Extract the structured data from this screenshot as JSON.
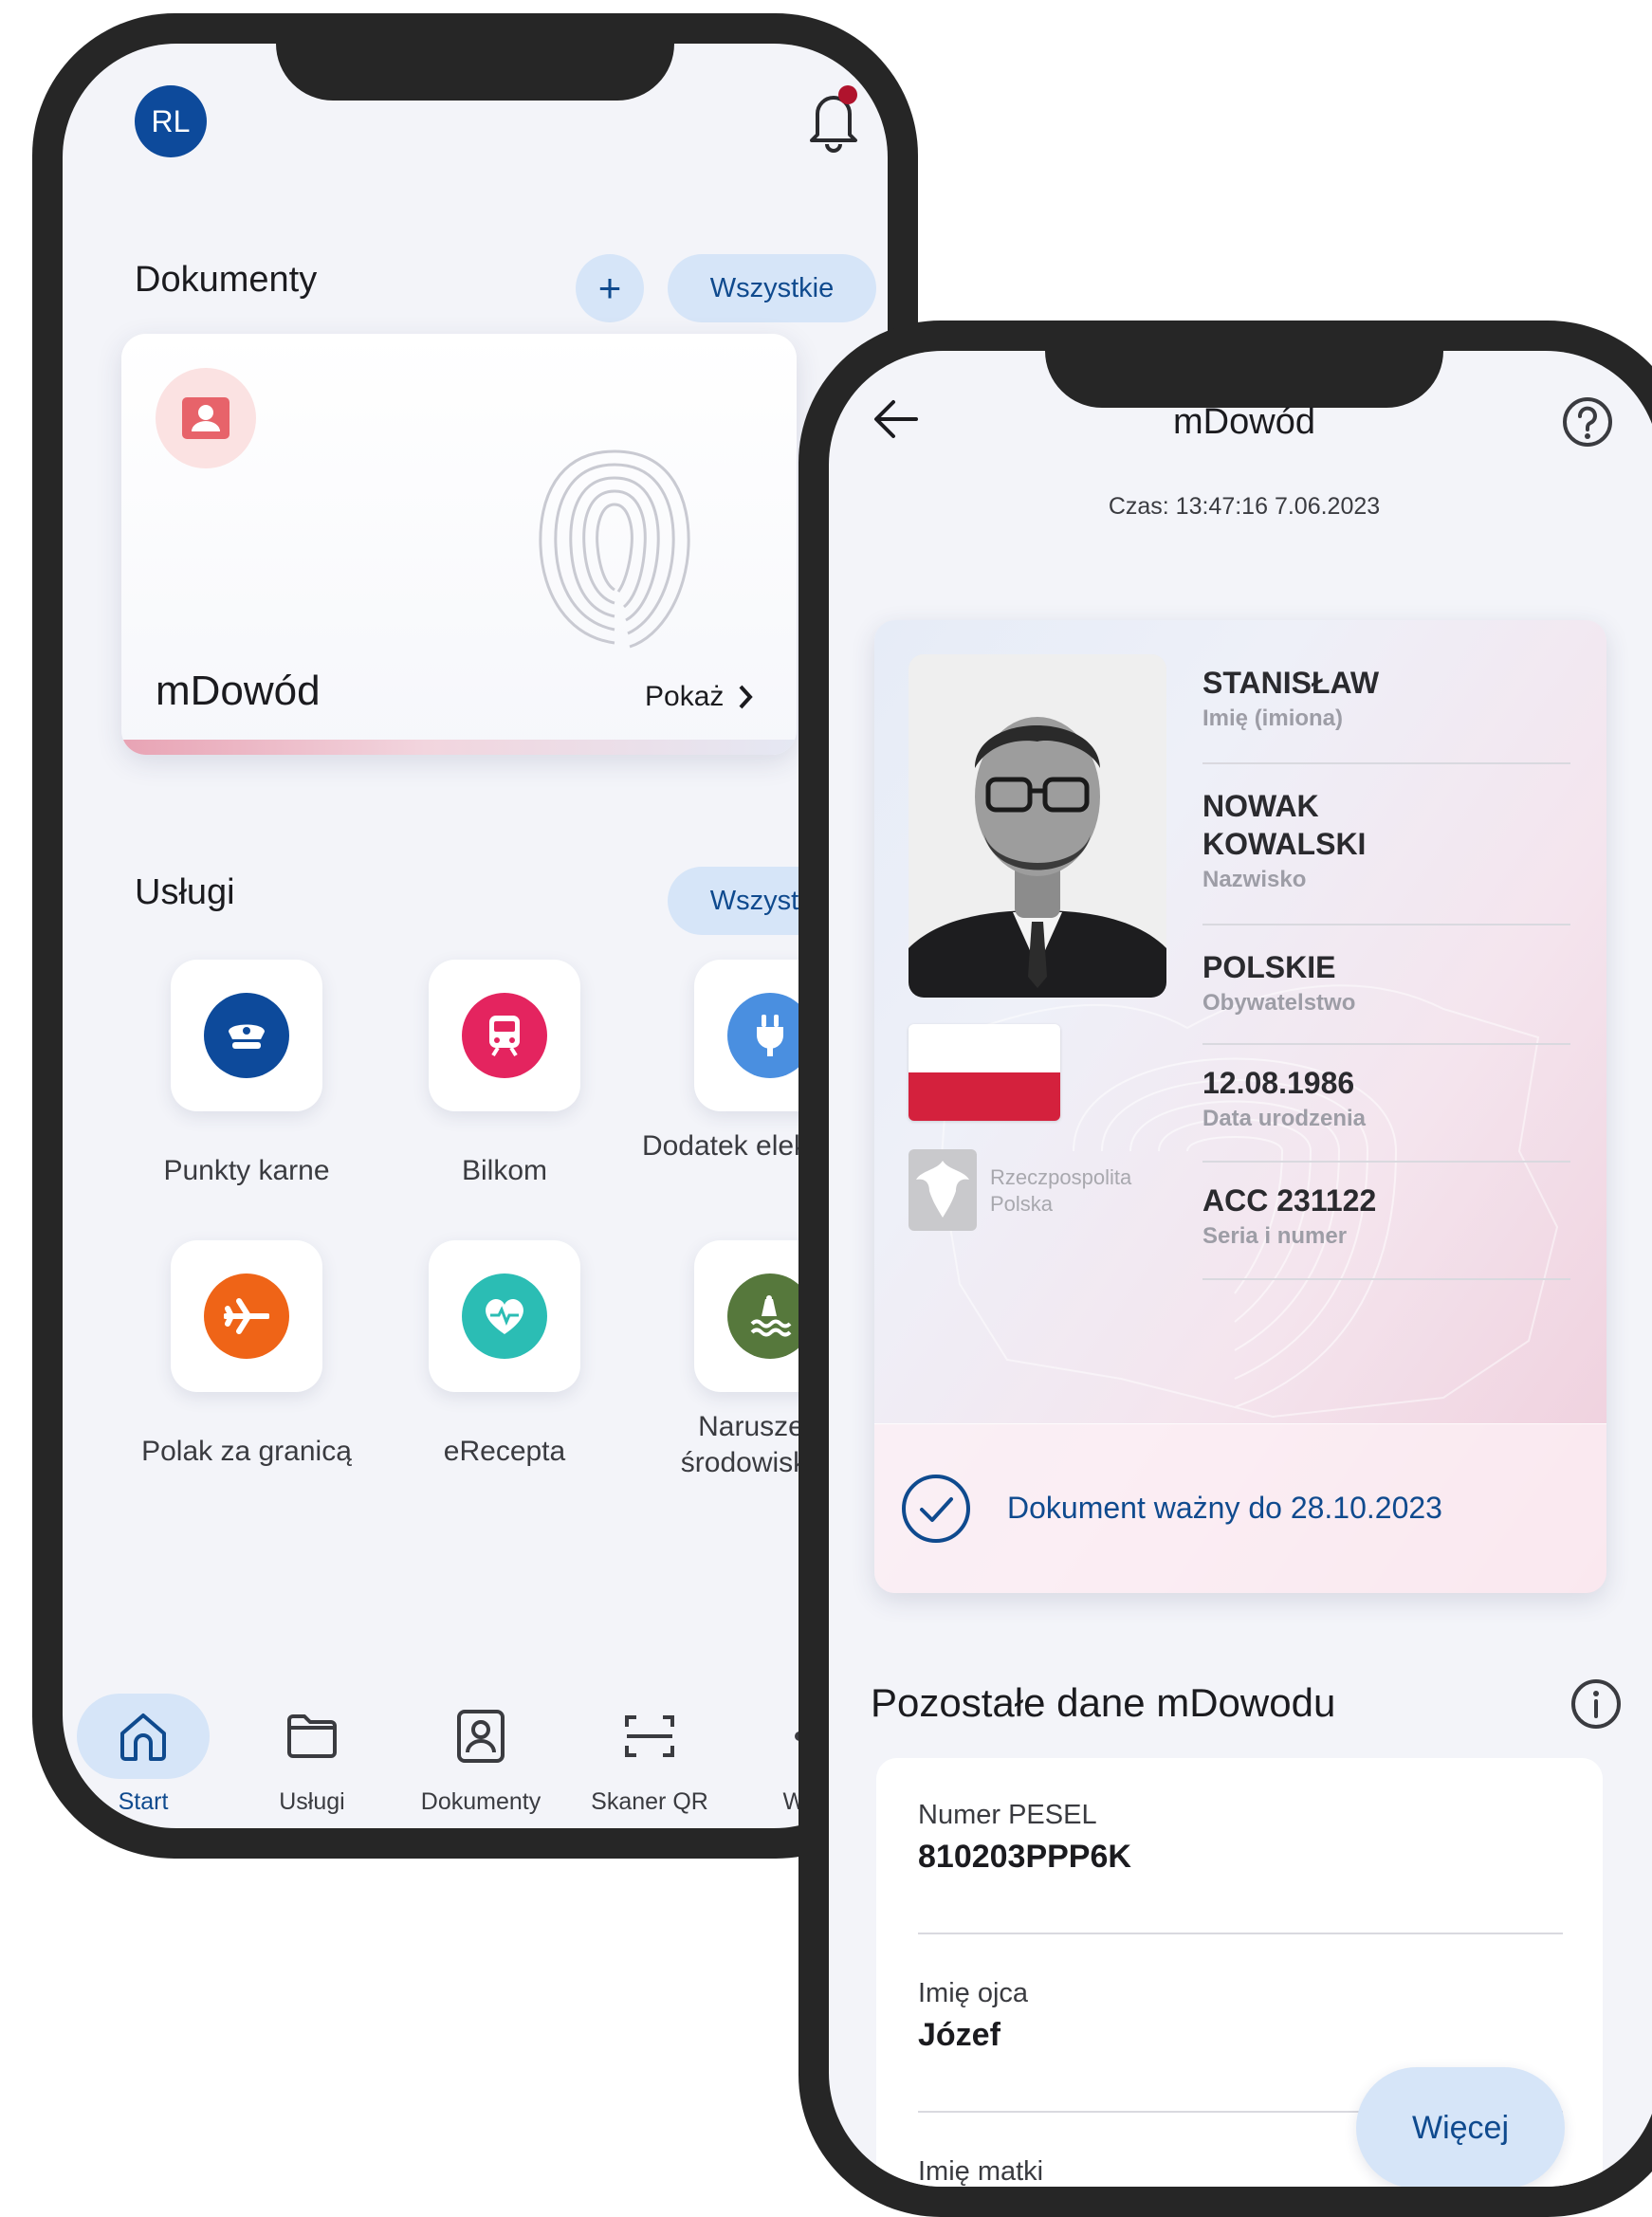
{
  "phone1": {
    "avatar_initials": "RL",
    "documents": {
      "title": "Dokumenty",
      "add_label": "+",
      "all_label": "Wszystkie"
    },
    "doc_card": {
      "title": "mDowód",
      "show_label": "Pokaż"
    },
    "services": {
      "title": "Usługi",
      "all_label": "Wszystkie",
      "items": [
        {
          "label": "Punkty karne",
          "icon": "police-cap-icon",
          "color": "#0d4a9b"
        },
        {
          "label": "Bilkom",
          "icon": "train-icon",
          "color": "#e4245f"
        },
        {
          "label": "Dodatek elektryczny",
          "icon": "plug-icon",
          "color": "#4a8fe0"
        },
        {
          "label": "Polak za granicą",
          "icon": "airplane-icon",
          "color": "#ef6417"
        },
        {
          "label": "eRecepta",
          "icon": "heart-pulse-icon",
          "color": "#2bbdb4"
        },
        {
          "label": "Naruszenie środowiskowe",
          "icon": "pollution-icon",
          "color": "#56783c"
        }
      ]
    },
    "nav": [
      {
        "label": "Start",
        "icon": "home-icon",
        "active": true
      },
      {
        "label": "Usługi",
        "icon": "folder-icon",
        "active": false
      },
      {
        "label": "Dokumenty",
        "icon": "id-card-icon",
        "active": false
      },
      {
        "label": "Skaner QR",
        "icon": "qr-scan-icon",
        "active": false
      },
      {
        "label": "Więcej",
        "icon": "more-icon",
        "active": false
      }
    ]
  },
  "phone2": {
    "title": "mDowód",
    "time": "Czas: 13:47:16 7.06.2023",
    "id": {
      "fields": [
        {
          "value": "STANISŁAW",
          "label": "Imię (imiona)"
        },
        {
          "value": "NOWAK\nKOWALSKI",
          "label": "Nazwisko"
        },
        {
          "value": "POLSKIE",
          "label": "Obywatelstwo"
        },
        {
          "value": "12.08.1986",
          "label": "Data urodzenia"
        },
        {
          "value": "ACC 231122",
          "label": "Seria i numer"
        }
      ],
      "country_line1": "Rzeczpospolita",
      "country_line2": "Polska",
      "valid_text": "Dokument ważny do 28.10.2023"
    },
    "other_data": {
      "title": "Pozostałe dane mDowodu",
      "rows": [
        {
          "label": "Numer PESEL",
          "value": "810203PPP6K"
        },
        {
          "label": "Imię ojca",
          "value": "Józef"
        },
        {
          "label": "Imię matki",
          "value": ""
        }
      ]
    },
    "more_label": "Więcej"
  }
}
